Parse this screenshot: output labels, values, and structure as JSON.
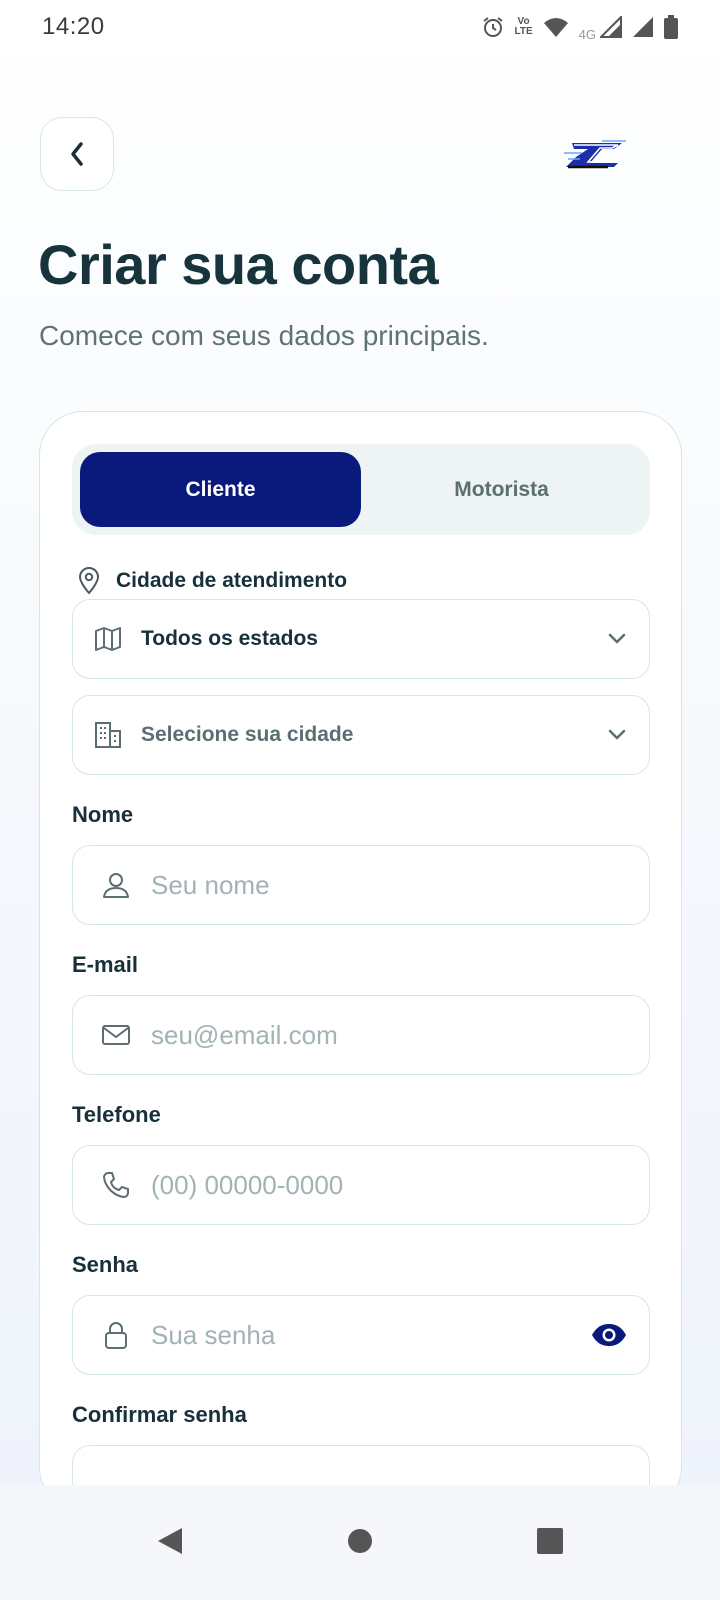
{
  "status_bar": {
    "time": "14:20",
    "lte_top": "Vo",
    "lte_bottom": "LTE",
    "network": "4G",
    "icons": [
      "alarm-icon",
      "volte-icon",
      "wifi-icon",
      "signal-icon",
      "signal-icon",
      "battery-icon"
    ]
  },
  "header": {
    "back_icon": "chevron-left-icon",
    "logo_text": "5Z"
  },
  "page": {
    "title": "Criar sua conta",
    "subtitle": "Comece com seus dados principais."
  },
  "account_type": {
    "tabs": [
      {
        "label": "Cliente",
        "active": true
      },
      {
        "label": "Motorista",
        "active": false
      }
    ],
    "active_color": "#0a1a7c"
  },
  "service_city": {
    "label": "Cidade de atendimento",
    "state_select": {
      "value": "Todos os estados",
      "icon": "map-icon"
    },
    "city_select": {
      "placeholder": "Selecione sua cidade",
      "icon": "building-icon"
    }
  },
  "form": {
    "name": {
      "label": "Nome",
      "placeholder": "Seu nome",
      "value": "",
      "icon": "user-icon"
    },
    "email": {
      "label": "E-mail",
      "placeholder": "seu@email.com",
      "value": "",
      "icon": "mail-icon"
    },
    "phone": {
      "label": "Telefone",
      "placeholder": "(00) 00000-0000",
      "value": "",
      "icon": "phone-icon"
    },
    "password": {
      "label": "Senha",
      "placeholder": "Sua senha",
      "value": "",
      "icon": "lock-icon"
    },
    "confirm_password": {
      "label": "Confirmar senha",
      "placeholder": "",
      "value": ""
    }
  },
  "nav": {
    "items": [
      "back-triangle-icon",
      "home-circle-icon",
      "recents-square-icon"
    ]
  }
}
